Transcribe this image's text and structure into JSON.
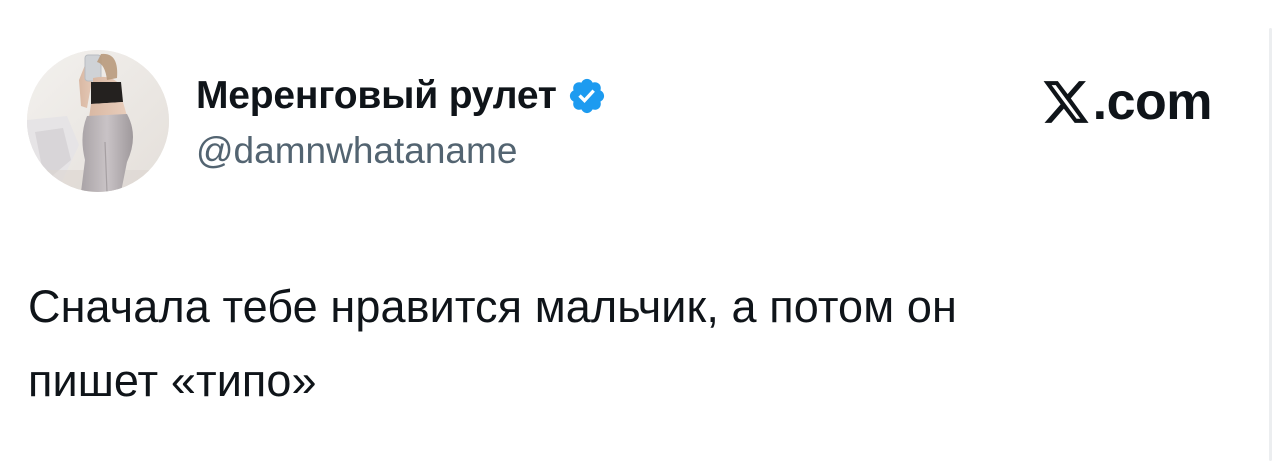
{
  "author": {
    "display_name": "Меренговый рулет",
    "handle": "@damnwhataname",
    "verified": true
  },
  "brand": {
    "logo_icon": "x-logo-icon",
    "suffix": ".com"
  },
  "tweet": {
    "text": "Сначала тебе нравится мальчик, а потом он\nпишет «типо»"
  },
  "colors": {
    "text_primary": "#0f1419",
    "text_secondary": "#536471",
    "verified_blue": "#1d9bf0",
    "background": "#ffffff"
  }
}
